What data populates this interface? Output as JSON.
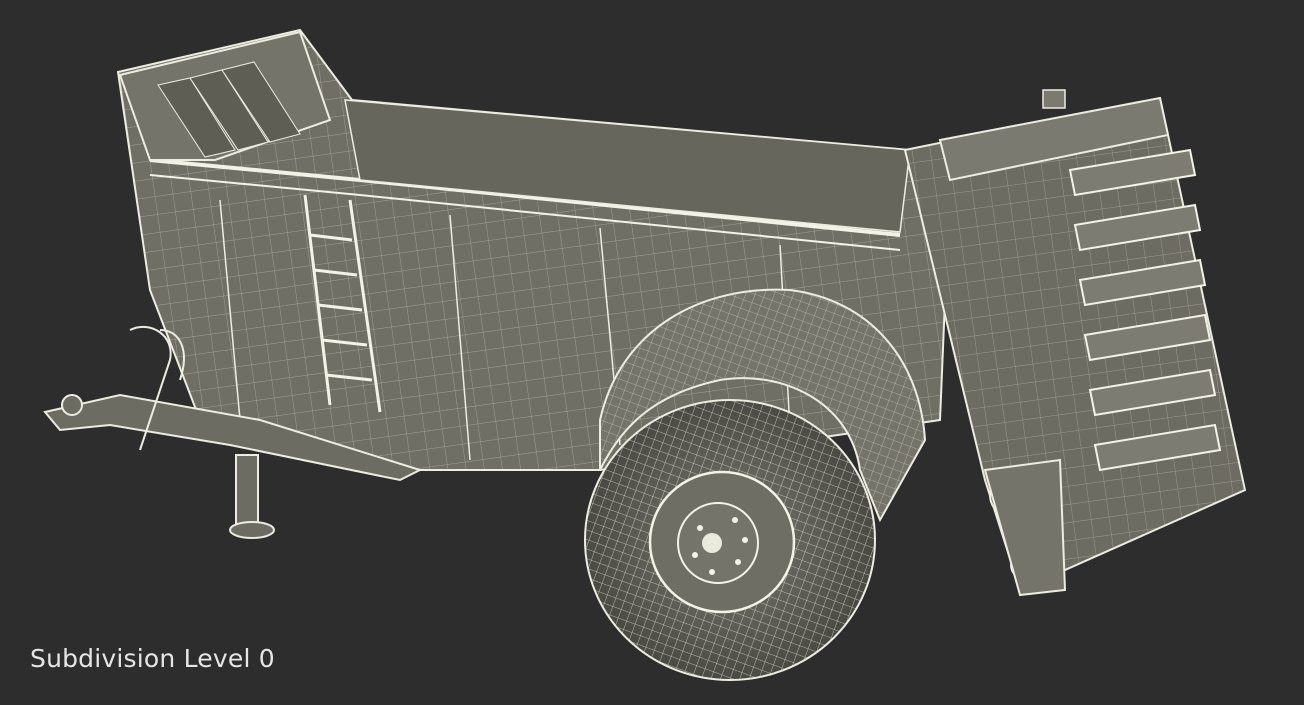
{
  "render": {
    "subject": "manure-spreader-wireframe",
    "background_color": "#2d2d2d",
    "mesh_fill_color": "#76766c",
    "wire_color": "#e9e9dc"
  },
  "caption": {
    "text": "Subdivision Level 0"
  }
}
